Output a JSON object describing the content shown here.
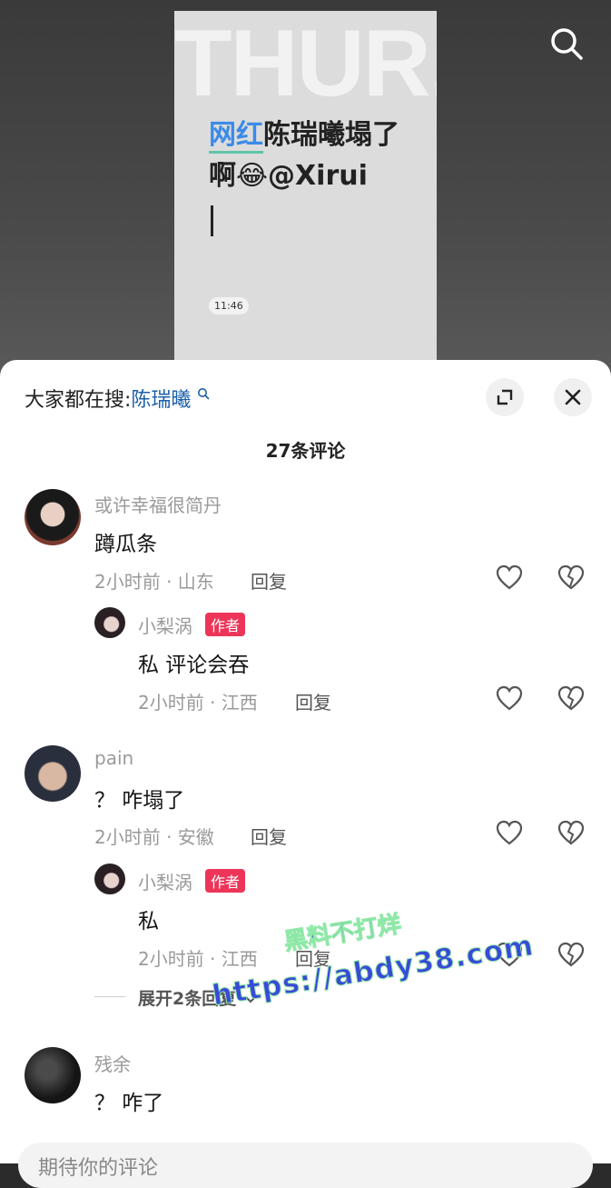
{
  "video": {
    "watermark_text": "THUR.",
    "note_highlight": "网红",
    "note_rest": "陈瑞曦塌了啊😂@Xirui",
    "time": "11:46"
  },
  "sheet": {
    "trend_prefix": "大家都在搜:",
    "trend_keyword": "陈瑞曦",
    "comment_count": "27条评论"
  },
  "comments": [
    {
      "user": "或许幸福很简丹",
      "text": "蹲瓜条",
      "meta": "2小时前 · 山东",
      "reply": "回复"
    },
    {
      "user": "小梨涡",
      "badge": "作者",
      "text": "私 评论会吞",
      "meta": "2小时前 · 江西",
      "reply": "回复"
    },
    {
      "user": "pain",
      "text": "？ 咋塌了",
      "meta": "2小时前 · 安徽",
      "reply": "回复"
    },
    {
      "user": "小梨涡",
      "badge": "作者",
      "text": "私",
      "meta": "2小时前 · 江西",
      "reply": "回复"
    },
    {
      "user": "残余",
      "text": "？ 咋了"
    }
  ],
  "expand_label": "展开2条回复",
  "overlay": {
    "line1": "黑料不打烊",
    "line2": "https://abdy38.com"
  },
  "input_placeholder": "期待你的评论",
  "colors": {
    "author_badge": "#ec3559",
    "keyword": "#1d5fa8"
  }
}
